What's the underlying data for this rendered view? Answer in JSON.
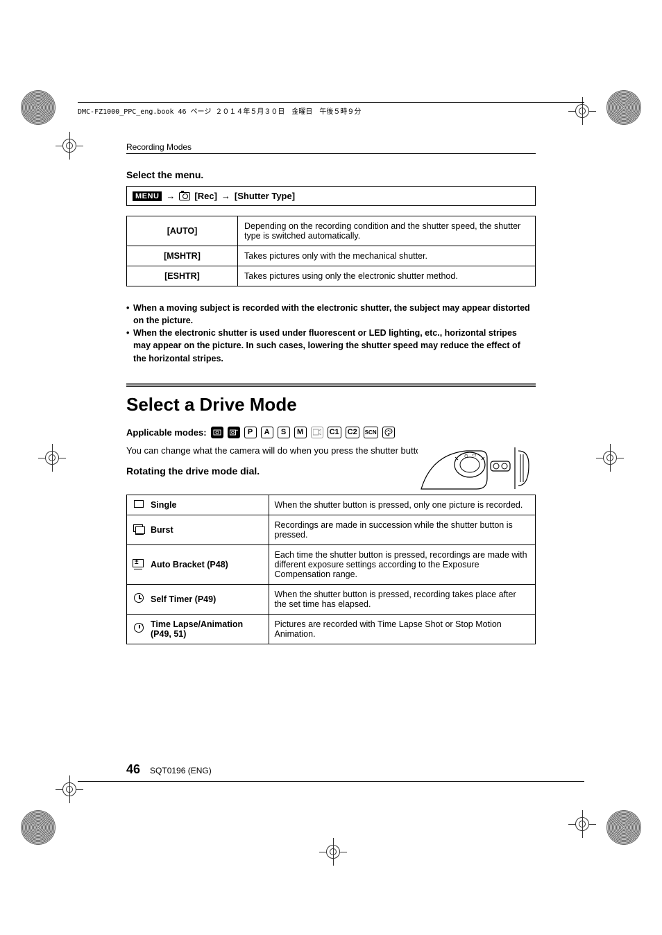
{
  "header_line": "DMC-FZ1000_PPC_eng.book  46 ページ  ２０１４年５月３０日　金曜日　午後５時９分",
  "section_label": "Recording Modes",
  "select_menu_heading": "Select the menu.",
  "menu_path": {
    "menu_label": "MENU",
    "arrow1": "→",
    "rec": "[Rec]",
    "arrow2": "→",
    "shutter": "[Shutter Type]"
  },
  "shutter_options": [
    {
      "key": "[AUTO]",
      "desc": "Depending on the recording condition and the shutter speed, the shutter type is switched automatically."
    },
    {
      "key": "[MSHTR]",
      "desc": "Takes pictures only with the mechanical shutter."
    },
    {
      "key": "[ESHTR]",
      "desc": "Takes pictures using only the electronic shutter method."
    }
  ],
  "notes": [
    "When a moving subject is recorded with the electronic shutter, the subject may appear distorted on the picture.",
    "When the electronic shutter is used under fluorescent or LED lighting, etc., horizontal stripes may appear on the picture. In such cases, lowering the shutter speed may reduce the effect of the horizontal stripes."
  ],
  "drive_heading": "Select a Drive Mode",
  "applicable_label": "Applicable modes:",
  "mode_icons": [
    "iA",
    "iA+",
    "P",
    "A",
    "S",
    "M",
    "movie",
    "C1",
    "C2",
    "SCN",
    "ART"
  ],
  "drive_intro": "You can change what the camera will do when you press the shutter button.",
  "rotating_heading": "Rotating the drive mode dial.",
  "drive_modes": [
    {
      "icon": "single",
      "label": "Single",
      "desc": "When the shutter button is pressed, only one picture is recorded."
    },
    {
      "icon": "burst",
      "label": "Burst",
      "desc": "Recordings are made in succession while the shutter button is pressed."
    },
    {
      "icon": "bracket",
      "label": "Auto Bracket (P48)",
      "desc": "Each time the shutter button is pressed, recordings are made with different exposure settings according to the Exposure Compensation range."
    },
    {
      "icon": "timer",
      "label": "Self Timer (P49)",
      "desc": "When the shutter button is pressed, recording takes place after the set time has elapsed."
    },
    {
      "icon": "time",
      "label": "Time Lapse/Animation (P49, 51)",
      "desc": "Pictures are recorded with Time Lapse Shot or Stop Motion Animation."
    }
  ],
  "footer": {
    "page": "46",
    "code": "SQT0196 (ENG)"
  }
}
